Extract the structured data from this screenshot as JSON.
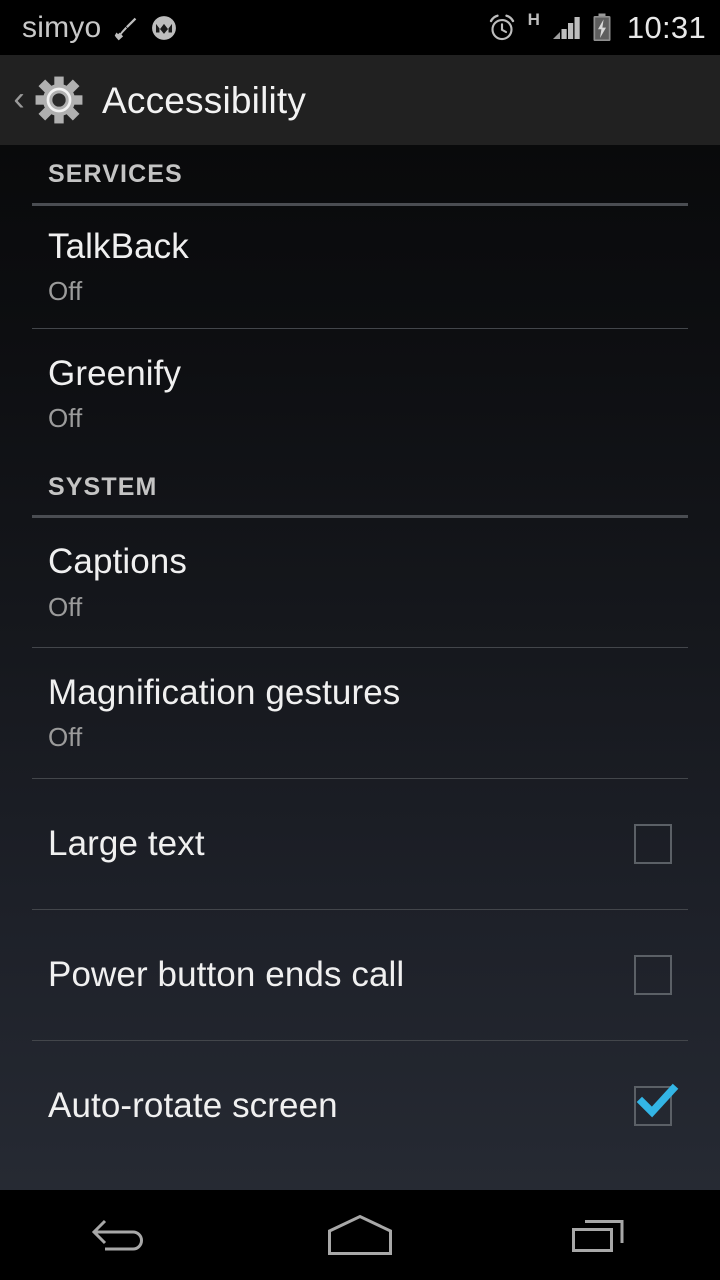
{
  "status_bar": {
    "carrier": "simyo",
    "icons": [
      "broom-icon",
      "motorola-logo-icon",
      "alarm-clock-icon",
      "signal-bars-icon",
      "battery-charging-icon"
    ],
    "network_type": "H",
    "clock": "10:31"
  },
  "action_bar": {
    "back_label": "‹",
    "app_icon": "gear-icon",
    "title": "Accessibility"
  },
  "sections": [
    {
      "header": "SERVICES",
      "items": [
        {
          "title": "TalkBack",
          "summary": "Off",
          "control": "none"
        },
        {
          "title": "Greenify",
          "summary": "Off",
          "control": "none"
        }
      ]
    },
    {
      "header": "SYSTEM",
      "items": [
        {
          "title": "Captions",
          "summary": "Off",
          "control": "none"
        },
        {
          "title": "Magnification gestures",
          "summary": "Off",
          "control": "none"
        },
        {
          "title": "Large text",
          "summary": "",
          "control": "checkbox",
          "checked": false
        },
        {
          "title": "Power button ends call",
          "summary": "",
          "control": "checkbox",
          "checked": false
        },
        {
          "title": "Auto-rotate screen",
          "summary": "",
          "control": "checkbox",
          "checked": true
        }
      ]
    }
  ],
  "nav_bar": {
    "buttons": [
      {
        "name": "back-icon",
        "label": "Back"
      },
      {
        "name": "home-icon",
        "label": "Home"
      },
      {
        "name": "recents-icon",
        "label": "Recents"
      }
    ]
  },
  "colors": {
    "accent_check": "#33b5e5",
    "action_bar_bg": "#212121",
    "status_bar_bg": "#000000",
    "title_text": "#f0f0f0",
    "summary_text": "#9b9b9b"
  }
}
